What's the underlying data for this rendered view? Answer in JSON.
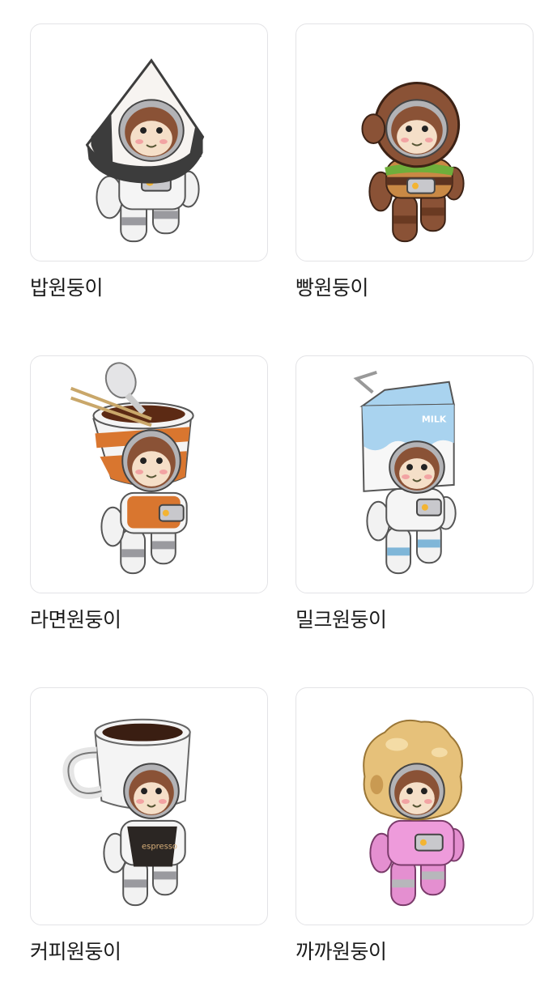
{
  "characters": [
    {
      "name": "밥원둥이",
      "icon": "rice-ball-monkey-astronaut-icon",
      "accent": "#3a3a3a"
    },
    {
      "name": "빵원둥이",
      "icon": "burger-monkey-astronaut-icon",
      "accent": "#8a5236"
    },
    {
      "name": "라면원둥이",
      "icon": "cup-ramen-monkey-astronaut-icon",
      "accent": "#d9762f"
    },
    {
      "name": "밀크원둥이",
      "icon": "milk-carton-monkey-astronaut-icon",
      "accent": "#a9d3ef"
    },
    {
      "name": "커피원둥이",
      "icon": "coffee-mug-monkey-astronaut-icon",
      "accent": "#2b2623"
    },
    {
      "name": "까까원둥이",
      "icon": "cream-puff-monkey-astronaut-icon",
      "accent": "#e48fd0"
    }
  ]
}
